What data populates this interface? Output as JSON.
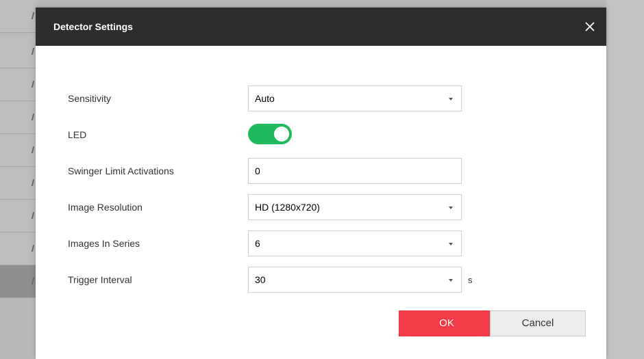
{
  "dialog": {
    "title": "Detector Settings",
    "close_icon": "close-icon"
  },
  "fields": {
    "sensitivity": {
      "label": "Sensitivity",
      "value": "Auto"
    },
    "led": {
      "label": "LED",
      "enabled": true
    },
    "swinger": {
      "label": "Swinger Limit Activations",
      "value": "0"
    },
    "resolution": {
      "label": "Image Resolution",
      "value": "HD (1280x720)"
    },
    "images_in_series": {
      "label": "Images In Series",
      "value": "6"
    },
    "trigger_interval": {
      "label": "Trigger Interval",
      "value": "30",
      "unit": "s"
    }
  },
  "buttons": {
    "ok": "OK",
    "cancel": "Cancel"
  },
  "colors": {
    "header": "#2d2d2d",
    "ok_button": "#f23b48",
    "toggle_on": "#1fba5b"
  }
}
